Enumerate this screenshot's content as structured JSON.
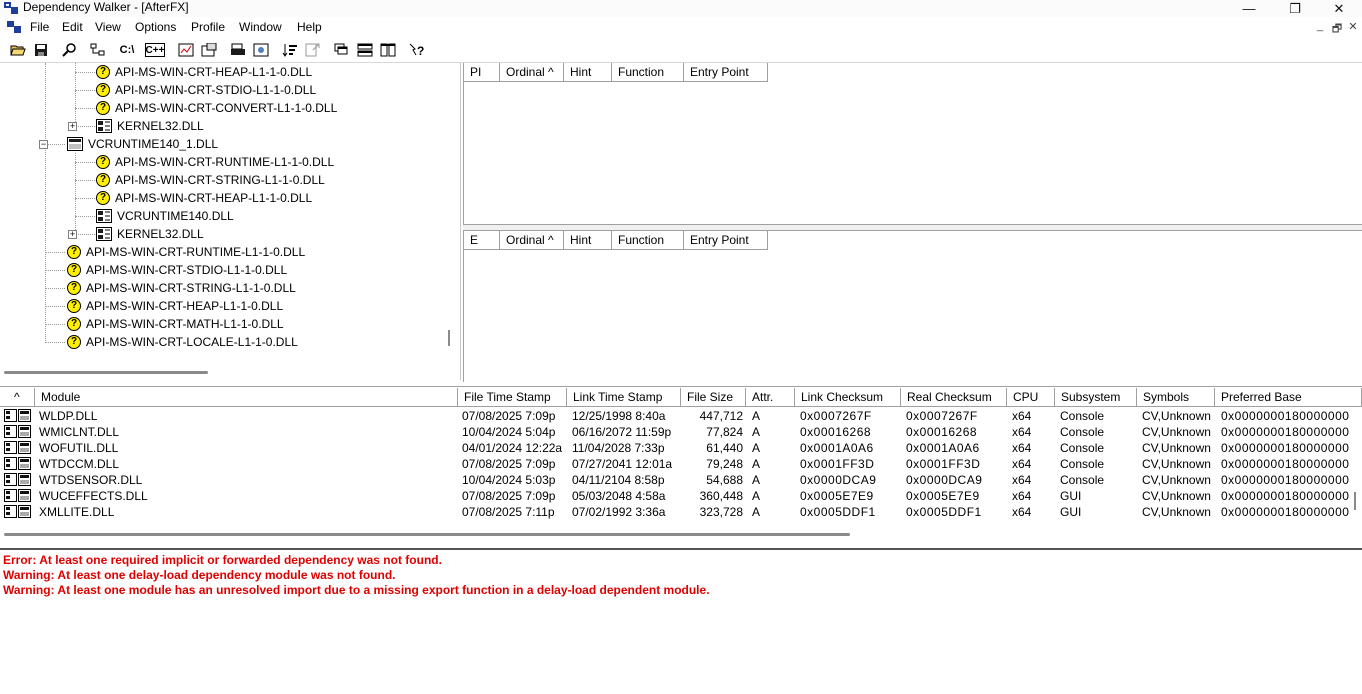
{
  "window": {
    "title": "Dependency Walker - [AfterFX]",
    "controls": {
      "minimize": "—",
      "maximize": "❐",
      "close": "✕"
    }
  },
  "menubar": {
    "items": [
      "File",
      "Edit",
      "View",
      "Options",
      "Profile",
      "Window",
      "Help"
    ],
    "mdi_controls": {
      "minimize": "_",
      "restore": "🗗",
      "close": "✕"
    }
  },
  "toolbar": {
    "buttons": [
      {
        "name": "open-icon"
      },
      {
        "name": "save-icon"
      },
      {
        "name": "find-icon"
      },
      {
        "name": "module-tree-icon"
      },
      {
        "name": "c-path-icon",
        "label": "C:\\"
      },
      {
        "name": "cpp-icon",
        "label": "C++"
      },
      {
        "name": "profile-icon"
      },
      {
        "name": "properties-icon"
      },
      {
        "name": "print-icon"
      },
      {
        "name": "view-icon"
      },
      {
        "name": "sort-icon"
      },
      {
        "name": "external-viewer-icon"
      },
      {
        "name": "cascade-icon"
      },
      {
        "name": "tile-horizontal-icon"
      },
      {
        "name": "tile-vertical-icon"
      },
      {
        "name": "help-icon"
      }
    ]
  },
  "tree": {
    "items": [
      {
        "label": "API-MS-WIN-CRT-HEAP-L1-1-0.DLL",
        "icon": "question"
      },
      {
        "label": "API-MS-WIN-CRT-STDIO-L1-1-0.DLL",
        "icon": "question"
      },
      {
        "label": "API-MS-WIN-CRT-CONVERT-L1-1-0.DLL",
        "icon": "question"
      },
      {
        "label": "KERNEL32.DLL",
        "icon": "module",
        "expander": "+"
      },
      {
        "label": "VCRUNTIME140_1.DLL",
        "icon": "module",
        "expander": "−"
      },
      {
        "label": "API-MS-WIN-CRT-RUNTIME-L1-1-0.DLL",
        "icon": "question"
      },
      {
        "label": "API-MS-WIN-CRT-STRING-L1-1-0.DLL",
        "icon": "question"
      },
      {
        "label": "API-MS-WIN-CRT-HEAP-L1-1-0.DLL",
        "icon": "question"
      },
      {
        "label": "VCRUNTIME140.DLL",
        "icon": "module"
      },
      {
        "label": "KERNEL32.DLL",
        "icon": "module",
        "expander": "+"
      },
      {
        "label": "API-MS-WIN-CRT-RUNTIME-L1-1-0.DLL",
        "icon": "question"
      },
      {
        "label": "API-MS-WIN-CRT-STDIO-L1-1-0.DLL",
        "icon": "question"
      },
      {
        "label": "API-MS-WIN-CRT-STRING-L1-1-0.DLL",
        "icon": "question"
      },
      {
        "label": "API-MS-WIN-CRT-HEAP-L1-1-0.DLL",
        "icon": "question"
      },
      {
        "label": "API-MS-WIN-CRT-MATH-L1-1-0.DLL",
        "icon": "question"
      },
      {
        "label": "API-MS-WIN-CRT-LOCALE-L1-1-0.DLL",
        "icon": "question"
      }
    ]
  },
  "imports_pane": {
    "headers": [
      "PI",
      "Ordinal ^",
      "Hint",
      "Function",
      "Entry Point"
    ]
  },
  "exports_pane": {
    "headers": [
      "E",
      "Ordinal ^",
      "Hint",
      "Function",
      "Entry Point"
    ]
  },
  "modules": {
    "headers": [
      "^",
      "Module",
      "File Time Stamp",
      "Link Time Stamp",
      "File Size",
      "Attr.",
      "Link Checksum",
      "Real Checksum",
      "CPU",
      "Subsystem",
      "Symbols",
      "Preferred Base"
    ],
    "rows": [
      [
        "WLDP.DLL",
        "07/08/2025  7:09p",
        "12/25/1998  8:40a",
        "447,712",
        "A",
        "0x0007267F",
        "0x0007267F",
        "x64",
        "Console",
        "CV,Unknown",
        "0x0000000180000000"
      ],
      [
        "WMICLNT.DLL",
        "10/04/2024  5:04p",
        "06/16/2072 11:59p",
        "77,824",
        "A",
        "0x00016268",
        "0x00016268",
        "x64",
        "Console",
        "CV,Unknown",
        "0x0000000180000000"
      ],
      [
        "WOFUTIL.DLL",
        "04/01/2024 12:22a",
        "11/04/2028  7:33p",
        "61,440",
        "A",
        "0x0001A0A6",
        "0x0001A0A6",
        "x64",
        "Console",
        "CV,Unknown",
        "0x0000000180000000"
      ],
      [
        "WTDCCM.DLL",
        "07/08/2025  7:09p",
        "07/27/2041 12:01a",
        "79,248",
        "A",
        "0x0001FF3D",
        "0x0001FF3D",
        "x64",
        "Console",
        "CV,Unknown",
        "0x0000000180000000"
      ],
      [
        "WTDSENSOR.DLL",
        "10/04/2024  5:03p",
        "04/11/2104  8:58p",
        "54,688",
        "A",
        "0x0000DCA9",
        "0x0000DCA9",
        "x64",
        "Console",
        "CV,Unknown",
        "0x0000000180000000"
      ],
      [
        "WUCEFFECTS.DLL",
        "07/08/2025  7:09p",
        "05/03/2048  4:58a",
        "360,448",
        "A",
        "0x0005E7E9",
        "0x0005E7E9",
        "x64",
        "GUI",
        "CV,Unknown",
        "0x0000000180000000"
      ],
      [
        "XMLLITE.DLL",
        "07/08/2025  7:11p",
        "07/02/1992  3:36a",
        "323,728",
        "A",
        "0x0005DDF1",
        "0x0005DDF1",
        "x64",
        "GUI",
        "CV,Unknown",
        "0x0000000180000000"
      ]
    ]
  },
  "log": {
    "lines": [
      "Error: At least one required implicit or forwarded dependency was not found.",
      "Warning: At least one delay-load dependency module was not found.",
      "Warning: At least one module has an unresolved import due to a missing export function in a delay-load dependent module."
    ],
    "color": "#e00000"
  }
}
